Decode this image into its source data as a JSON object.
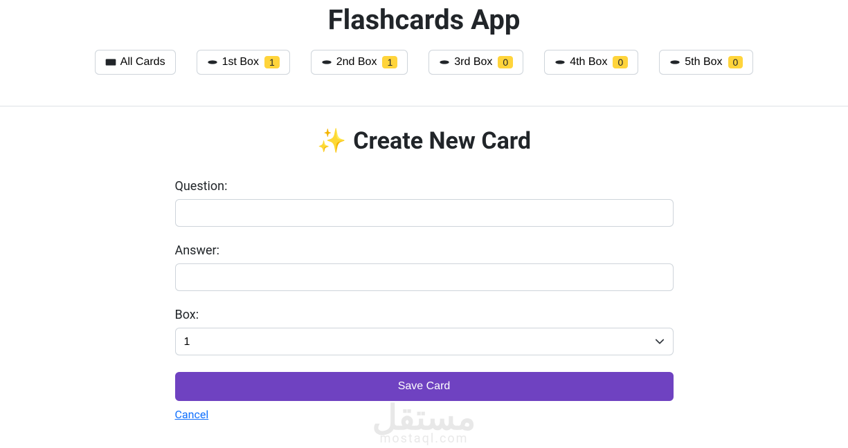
{
  "header": {
    "title": "Flashcards App",
    "nav": [
      {
        "label": "All Cards",
        "badge": null,
        "icon": "layers"
      },
      {
        "label": "1st Box",
        "badge": "1",
        "icon": "inbox"
      },
      {
        "label": "2nd Box",
        "badge": "1",
        "icon": "inbox"
      },
      {
        "label": "3rd Box",
        "badge": "0",
        "icon": "inbox"
      },
      {
        "label": "4th Box",
        "badge": "0",
        "icon": "inbox"
      },
      {
        "label": "5th Box",
        "badge": "0",
        "icon": "inbox"
      }
    ]
  },
  "form": {
    "title": "Create New Card",
    "question_label": "Question:",
    "question_value": "",
    "answer_label": "Answer:",
    "answer_value": "",
    "box_label": "Box:",
    "box_value": "1",
    "save_label": "Save Card",
    "cancel_label": "Cancel"
  },
  "watermark": {
    "big": "مستقل",
    "small": "mostaql.com"
  }
}
